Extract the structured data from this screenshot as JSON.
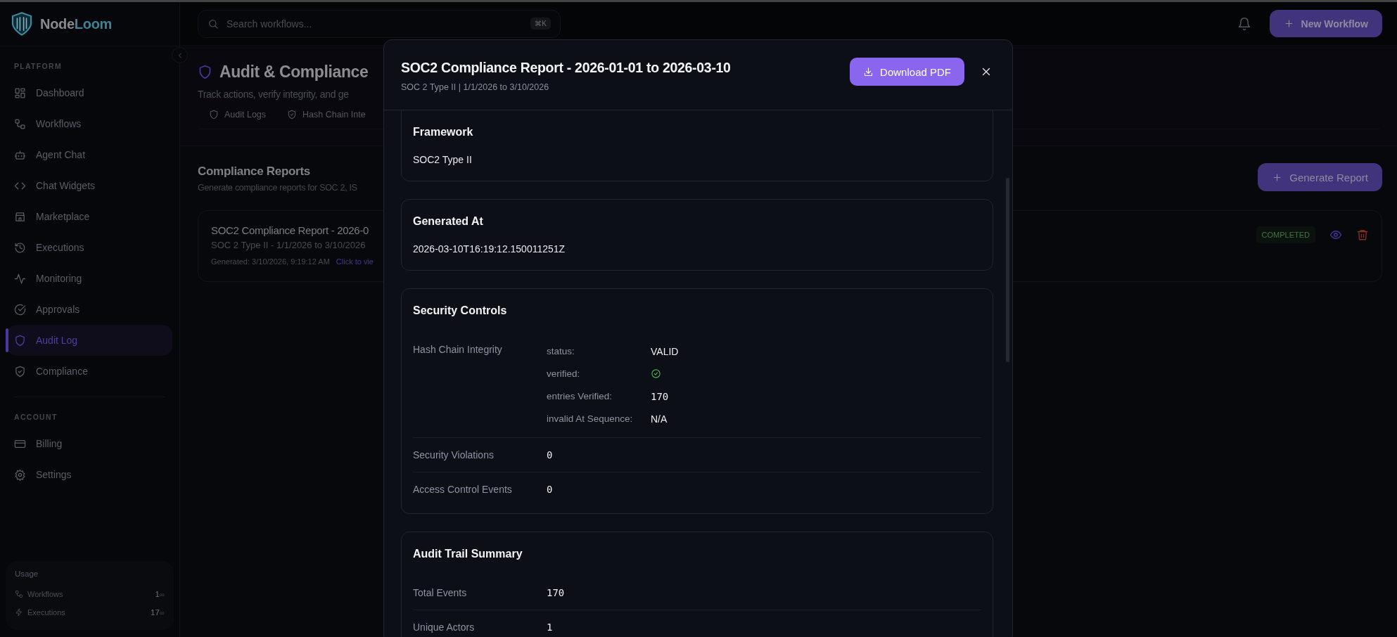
{
  "sidebar": {
    "logo": {
      "first": "Node",
      "second": "Loom"
    },
    "sections": [
      {
        "label": "PLATFORM",
        "items": [
          {
            "label": "Dashboard",
            "selected": false
          },
          {
            "label": "Workflows",
            "selected": false
          },
          {
            "label": "Agent Chat",
            "selected": false
          },
          {
            "label": "Chat Widgets",
            "selected": false
          },
          {
            "label": "Marketplace",
            "selected": false
          },
          {
            "label": "Executions",
            "selected": false
          },
          {
            "label": "Monitoring",
            "selected": false
          },
          {
            "label": "Approvals",
            "selected": false
          },
          {
            "label": "Audit Log",
            "selected": true
          },
          {
            "label": "Compliance",
            "selected": false
          }
        ]
      },
      {
        "label": "ACCOUNT",
        "items": [
          {
            "label": "Billing",
            "selected": false
          },
          {
            "label": "Settings",
            "selected": false
          }
        ]
      }
    ],
    "usage": {
      "title": "Usage",
      "rows": [
        {
          "label": "Workflows",
          "value": "1",
          "limit": "∞"
        },
        {
          "label": "Executions",
          "value": "17",
          "limit": "∞"
        }
      ]
    }
  },
  "topbar": {
    "search": {
      "placeholder": "Search workflows..."
    },
    "shortcut": "⌘K",
    "new_button": "New Workflow"
  },
  "page": {
    "title": "Audit & Compliance",
    "subtitle": "Track actions, verify integrity, and ge",
    "tabs": [
      {
        "label": "Audit Logs",
        "selected": false
      },
      {
        "label": "Hash Chain Inte",
        "selected": false
      }
    ],
    "reports": {
      "title": "Compliance Reports",
      "subtitle": "Generate compliance reports for SOC 2, IS",
      "generate_button": "Generate Report",
      "items": [
        {
          "title": "SOC2 Compliance Report - 2026-0",
          "subtitle": "SOC 2 Type II - 1/1/2026 to 3/10/2026",
          "generated": "Generated: 3/10/2026, 9:19:12 AM",
          "link": "Click to vie",
          "status": "COMPLETED"
        }
      ]
    }
  },
  "modal": {
    "title": "SOC2 Compliance Report - 2026-01-01 to 2026-03-10",
    "subtitle": "SOC 2 Type II | 1/1/2026 to 3/10/2026",
    "download_button": "Download PDF",
    "sections": [
      {
        "kind": "text",
        "title": "Framework",
        "value": "SOC2 Type II"
      },
      {
        "kind": "text",
        "title": "Generated At",
        "value": "2026-03-10T16:19:12.150011251Z"
      },
      {
        "kind": "table",
        "title": "Security Controls",
        "rows": [
          {
            "kind": "group",
            "label": "Hash Chain Integrity",
            "entries": [
              {
                "kind": "text",
                "key": "status:",
                "value": "VALID"
              },
              {
                "kind": "check",
                "key": "verified:",
                "checked": true
              },
              {
                "kind": "number",
                "key": "entries Verified:",
                "value": "170"
              },
              {
                "kind": "text",
                "key": "invalid At Sequence:",
                "value": "N/A"
              }
            ]
          },
          {
            "kind": "number",
            "label": "Security Violations",
            "value": "0"
          },
          {
            "kind": "number",
            "label": "Access Control Events",
            "value": "0"
          }
        ]
      },
      {
        "kind": "table",
        "title": "Audit Trail Summary",
        "rows": [
          {
            "kind": "number",
            "label": "Total Events",
            "value": "170"
          },
          {
            "kind": "number",
            "label": "Unique Actors",
            "value": "1"
          }
        ]
      }
    ]
  }
}
